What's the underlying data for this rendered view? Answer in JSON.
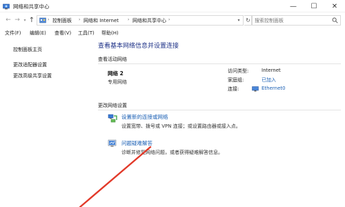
{
  "window": {
    "title": "网络和共享中心",
    "controls": {
      "minimize": "—",
      "maximize": "☐",
      "close": "✕"
    }
  },
  "address_bar": {
    "crumbs": [
      "控制面板",
      "网络和 Internet",
      "网络和共享中心"
    ],
    "refresh_glyph": "↻",
    "search_placeholder": "搜索控制面板"
  },
  "menu": {
    "items": [
      "文件(F)",
      "编辑(E)",
      "查看(V)",
      "工具(T)",
      "帮助(H)"
    ]
  },
  "sidebar": {
    "items": [
      {
        "label": "控制面板主页"
      },
      {
        "label": "更改适配器设置"
      },
      {
        "label": "更改高级共享设置"
      }
    ]
  },
  "main": {
    "title": "查看基本网络信息并设置连接",
    "active_networks_label": "查看活动网络",
    "network": {
      "name": "网络  2",
      "type": "专用网络",
      "access_type_label": "访问类型:",
      "access_type_value": "Internet",
      "homegroup_label": "家庭组:",
      "homegroup_value": "已加入",
      "connections_label": "连接:",
      "connections_value": "Ethernet0"
    },
    "change_settings_label": "更改网络设置",
    "tasks": [
      {
        "icon": "new-connection-icon",
        "title": "设置新的连接或网络",
        "desc": "设置宽带、拨号或 VPN 连接；或设置路由器或接入点。"
      },
      {
        "icon": "troubleshoot-icon",
        "title": "问题疑难解答",
        "desc": "诊断并修复网络问题，或者获得疑难解答信息。"
      }
    ]
  },
  "colors": {
    "title_blue": "#1e3287",
    "link_blue": "#1a5fb4",
    "annotation_arrow": "#e23a2a"
  }
}
